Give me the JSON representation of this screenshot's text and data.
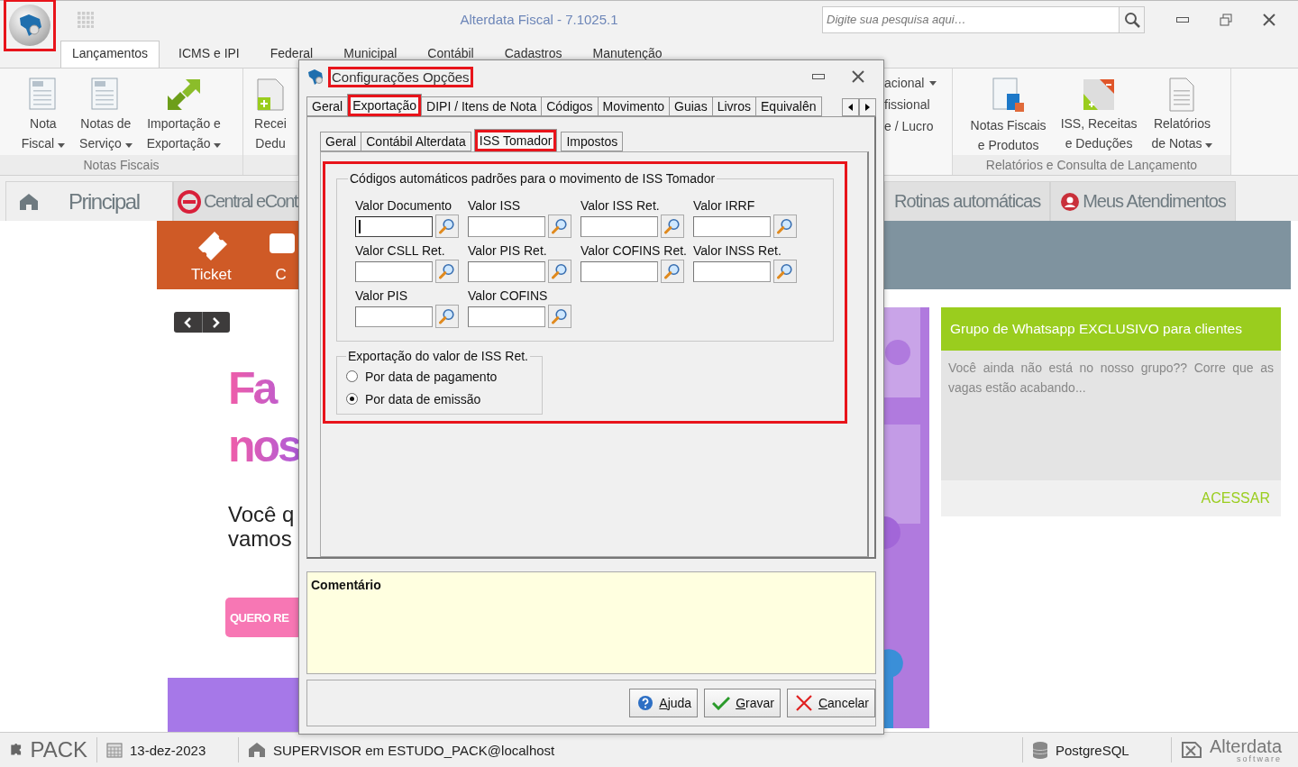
{
  "app": {
    "logo_highlighted": true,
    "title": "Alterdata Fiscal - 7.1025.1",
    "search": {
      "placeholder": "Digite sua pesquisa aqui…"
    }
  },
  "ribbon_tabs": [
    {
      "label": "Lançamentos",
      "selected": true
    },
    {
      "label": "ICMS e IPI",
      "selected": false
    },
    {
      "label": "Federal",
      "selected": false
    },
    {
      "label": "Municipal",
      "selected": false
    },
    {
      "label": "Contábil",
      "selected": false
    },
    {
      "label": "Cadastros",
      "selected": false
    },
    {
      "label": "Manutenção",
      "selected": false
    }
  ],
  "ribbon_left": [
    {
      "title": "Notas Fiscais",
      "buttons": [
        {
          "lines": [
            "Nota",
            "Fiscal"
          ],
          "dropdown": true,
          "kind": "nf"
        },
        {
          "lines": [
            "Notas de",
            "Serviço"
          ],
          "dropdown": true,
          "kind": "nfs"
        },
        {
          "lines": [
            "Importação e",
            "Exportação"
          ],
          "dropdown": true,
          "kind": "import"
        }
      ]
    },
    {
      "buttons": [
        {
          "lines": [
            "Recei",
            "Dedu"
          ],
          "dropdown": false,
          "kind": "plus-doc"
        }
      ]
    }
  ],
  "ribbon_right": {
    "small_items": [
      {
        "label": "acional",
        "dropdown": true
      },
      {
        "label": "fissional",
        "dropdown": false
      },
      {
        "label": "e / Lucro",
        "dropdown": false
      }
    ],
    "group": {
      "title": "Relatórios e Consulta de Lançamento",
      "buttons": [
        {
          "lines": [
            "Notas Fiscais",
            "e Produtos"
          ],
          "dropdown": false,
          "kind": "nf-products"
        },
        {
          "lines": [
            "ISS, Receitas",
            "e Deduções"
          ],
          "dropdown": false,
          "kind": "iss"
        },
        {
          "lines": [
            "Relatórios",
            "de Notas"
          ],
          "dropdown": true,
          "kind": "report"
        }
      ]
    }
  },
  "page_tabs_left": [
    {
      "label": "Principal",
      "kind": "home",
      "selected": true
    },
    {
      "label": "Central eCont",
      "kind": "econt",
      "selected": false
    }
  ],
  "page_tabs_right": [
    {
      "label": "Rotinas automáticas",
      "kind": "plain",
      "selected": false
    },
    {
      "label": "Meus Atendimentos",
      "kind": "support",
      "selected": false
    }
  ],
  "shortcuts": [
    {
      "label": "Ticket",
      "kind": "ticket"
    },
    {
      "label": "C",
      "kind": "chat"
    }
  ],
  "promo": {
    "headline": [
      "Fa",
      "nos"
    ],
    "text": [
      "Você q",
      "vamos"
    ],
    "button": "QUERO RE"
  },
  "card": {
    "title": "Grupo de Whatsapp EXCLUSIVO para clientes",
    "text": "Você ainda não está no nosso grupo?? Corre que as vagas estão acabando...",
    "link": "ACESSAR"
  },
  "dialog": {
    "title": "Configurações Opções",
    "title_highlighted": true,
    "tabs": [
      {
        "label": "Geral",
        "selected": false,
        "highlighted": false
      },
      {
        "label": "Exportação",
        "selected": true,
        "highlighted": true
      },
      {
        "label": "DIPI / Itens de Nota",
        "selected": false,
        "highlighted": false
      },
      {
        "label": "Códigos",
        "selected": false,
        "highlighted": false
      },
      {
        "label": "Movimento",
        "selected": false,
        "highlighted": false
      },
      {
        "label": "Guias",
        "selected": false,
        "highlighted": false
      },
      {
        "label": "Livros",
        "selected": false,
        "highlighted": false
      },
      {
        "label": "Equivalên",
        "selected": false,
        "highlighted": false
      }
    ],
    "subtabs": [
      {
        "label": "Geral",
        "selected": false,
        "highlighted": false
      },
      {
        "label": "Contábil Alterdata",
        "selected": false,
        "highlighted": false
      },
      {
        "label": "ISS Tomador",
        "selected": true,
        "highlighted": true
      },
      {
        "label": "Impostos",
        "selected": false,
        "highlighted": false
      }
    ],
    "settings_highlighted": true,
    "codes_group": {
      "title": "Códigos automáticos padrões para o movimento de ISS Tomador",
      "fields": [
        {
          "label": "Valor Documento",
          "focused": true
        },
        {
          "label": "Valor ISS",
          "focused": false
        },
        {
          "label": "Valor ISS Ret.",
          "focused": false
        },
        {
          "label": "Valor IRRF",
          "focused": false
        },
        {
          "label": "Valor CSLL Ret.",
          "focused": false
        },
        {
          "label": "Valor PIS Ret.",
          "focused": false
        },
        {
          "label": "Valor COFINS Ret.",
          "focused": false
        },
        {
          "label": "Valor INSS Ret.",
          "focused": false
        },
        {
          "label": "Valor PIS",
          "focused": false
        },
        {
          "label": "Valor COFINS",
          "focused": false
        }
      ]
    },
    "export_group": {
      "title": "Exportação do valor de ISS Ret.",
      "options": [
        {
          "label": "Por data de pagamento",
          "selected": false
        },
        {
          "label": "Por data de emissão",
          "selected": true
        }
      ]
    },
    "comment": {
      "label": "Comentário"
    },
    "buttons": [
      {
        "label": "Ajuda",
        "kind": "help"
      },
      {
        "label": "Gravar",
        "kind": "save"
      },
      {
        "label": "Cancelar",
        "kind": "cancel"
      }
    ]
  },
  "status_bar": {
    "product": "PACK",
    "date": "13-dez-2023",
    "user": "SUPERVISOR em ESTUDO_PACK@localhost",
    "database": "PostgreSQL",
    "brand": "Alterdata",
    "brand_sub": "software"
  }
}
